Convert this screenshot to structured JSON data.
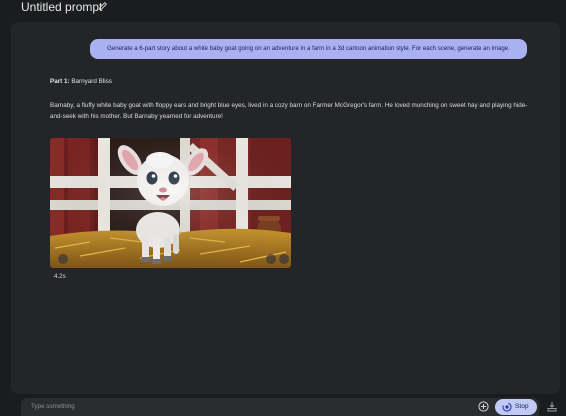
{
  "header": {
    "title": "Untitled prompt",
    "edit_icon": "pencil-icon"
  },
  "conversation": {
    "user_message": "Generate a 6-part story about a white baby goat going on an adventure in a farm in a 3d cartoon animation style. For each scene, generate an image.",
    "response": {
      "part_label": "Part 1:",
      "part_title": "Barnyard Bliss",
      "story_text": "Barnaby, a fluffy white baby goat with floppy ears and bright blue eyes, lived in a cozy barn on Farmer McGregor's farm. He loved munching on sweet hay and playing hide-and-seek with his mother. But Barnaby yearned for adventure!",
      "image_subject": "white baby goat standing on hay in a red barn",
      "image_icons": [
        "sparkle-icon",
        "download-icon",
        "more-icon"
      ],
      "generation_time": "4.2s"
    }
  },
  "composer": {
    "placeholder": "Type something",
    "add_icon": "plus-circle-icon",
    "stop_label": "Stop",
    "stop_icon": "stop-spinner-icon",
    "save_icon": "save-icon"
  },
  "colors": {
    "background": "#1b1c1e",
    "panel": "#242528",
    "user_bubble": "#a9b1f0",
    "stop_button": "#c1c9f5"
  }
}
